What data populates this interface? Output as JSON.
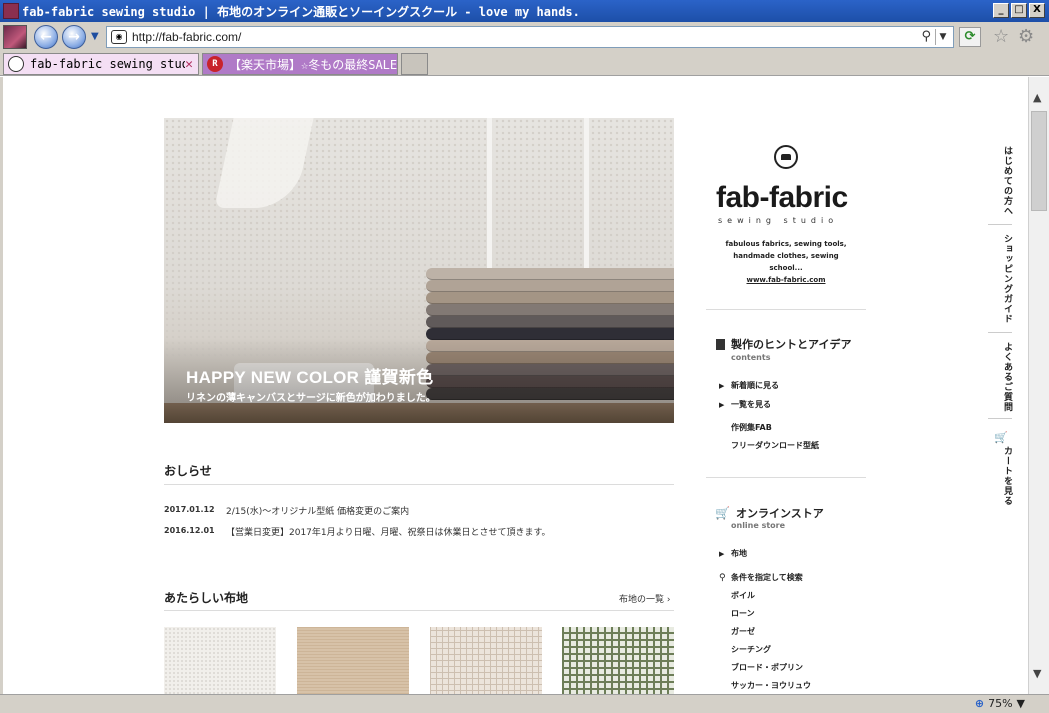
{
  "window": {
    "title": "fab-fabric sewing studio | 布地のオンライン通販とソーイングスクール - love my hands.",
    "minimize": "_",
    "maximize": "□",
    "close": "X"
  },
  "nav": {
    "back": "←",
    "forward": "→",
    "url": "http://fab-fabric.com/"
  },
  "tabs": [
    {
      "label": "fab-fabric sewing studio | ...",
      "active": true
    },
    {
      "label": "【楽天市場】☆冬もの最終SALE...",
      "active": false
    }
  ],
  "hero": {
    "title": "HAPPY NEW COLOR 謹賀新色",
    "subtitle": "リネンの薄キャンバスとサージに新色が加わりました。"
  },
  "news": {
    "heading": "おしらせ",
    "items": [
      {
        "date": "2017.01.12",
        "text": "2/15(水)～オリジナル型紙 価格変更のご案内"
      },
      {
        "date": "2016.12.01",
        "text": "【営業日変更】2017年1月より日曜、月曜、祝祭日は休業日とさせて頂きます。"
      }
    ]
  },
  "new_fabrics": {
    "heading": "あたらしい布地",
    "more": "布地の一覧 ›"
  },
  "sidebar": {
    "logo": "fab-fabric",
    "logo_sub": "sewing studio",
    "tagline_1": "fabulous fabrics, sewing tools,",
    "tagline_2": "handmade clothes, sewing school...",
    "tagline_url": "www.fab-fabric.com",
    "contents": {
      "title": "製作のヒントとアイデア",
      "sub": "contents",
      "items": [
        "新着順に見る",
        "一覧を見る",
        "作例集FAB",
        "フリーダウンロード型紙"
      ]
    },
    "store": {
      "title": "オンラインストア",
      "sub": "online store",
      "items": [
        "布地",
        "条件を指定して検索",
        "ボイル",
        "ローン",
        "ガーゼ",
        "シーチング",
        "ブロード・ポプリン",
        "サッカー・ヨウリュウ"
      ]
    }
  },
  "right_nav": [
    "はじめての方へ",
    "ショッピングガイド",
    "よくあるご質問",
    "カートを見る"
  ],
  "status": {
    "zoom": "75%"
  },
  "colors": {
    "titlebar": "#2b63c8",
    "tab_active": "#f4dff4",
    "tab_inactive": "#b07ac7"
  }
}
